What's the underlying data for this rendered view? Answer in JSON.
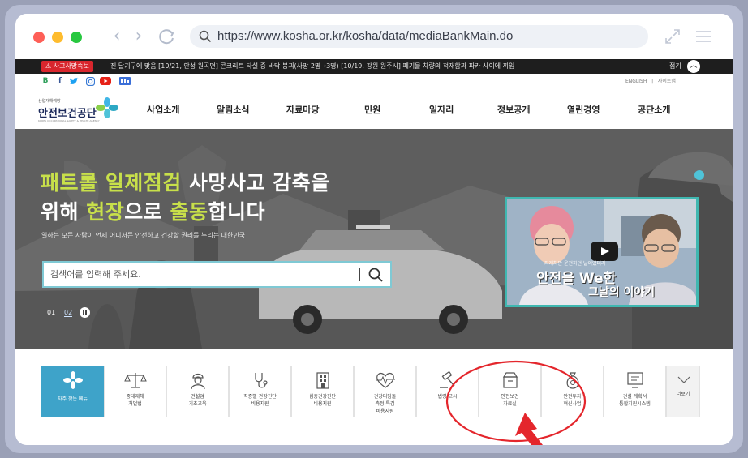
{
  "browser": {
    "url": "https://www.kosha.or.kr/kosha/data/mediaBankMain.do"
  },
  "notice": {
    "badge": "사고사망속보",
    "text": "진 달기구에 맞음   [10/21, 안성 원곡면] 콘크리트 타설 중 바닥 붕괴(사망 2명→3명)   [10/19, 강원 원주시] 폐기물 차량의 적재함과 파카 사이에 끼임",
    "close_label": "접기"
  },
  "util": {
    "sns": [
      "B",
      "f",
      "t",
      "in",
      "yt",
      "cafe"
    ],
    "english": "ENGLISH",
    "sep": "|",
    "sitemap": "사이트맵"
  },
  "logo": {
    "sub": "산업재해예방",
    "name": "안전보건공단",
    "eng": "KOREA OCCUPATIONAL SAFETY & HEALTH AGENCY"
  },
  "gnb": [
    "사업소개",
    "알림소식",
    "자료마당",
    "민원",
    "일자리",
    "정보공개",
    "열린경영",
    "공단소개"
  ],
  "hero": {
    "line1_hl": "패트롤 일제점검",
    "line1_rest": " 사망사고 감축을",
    "line2_a": "위해 ",
    "line2_hl1": "현장",
    "line2_b": "으로 ",
    "line2_hl2": "출동",
    "line2_c": "합니다",
    "sub": "일하는 모든 사람이 언제 어디서든 안전하고 건강할 권리를 누리는 대한민국",
    "search_placeholder": "검색어를 입력해 주세요.",
    "pager": [
      "01",
      "02"
    ]
  },
  "video": {
    "caption_small": "지게차만 운전하던 날이였더라",
    "caption_main": "안전을 We한",
    "caption_sub": "그날의 이야기"
  },
  "quick_menu": [
    {
      "label": "자주 찾는 메뉴"
    },
    {
      "label": "중대재해\n처벌법"
    },
    {
      "label": "건설업\n기초교육"
    },
    {
      "label": "직종별 건강진단\n비용지원"
    },
    {
      "label": "심층건강진단\n비용지원"
    },
    {
      "label": "건강디딤돌\n측정·특검\n비용지원"
    },
    {
      "label": "법령/고시"
    },
    {
      "label": "안전보건\n자료실"
    },
    {
      "label": "안전투자\n혁신사업"
    },
    {
      "label": "건설 계획서\n통합지원시스템"
    },
    {
      "label": "더보기"
    }
  ],
  "colors": {
    "accent": "#3ea3c9",
    "highlight": "#c8e04a",
    "notice_badge": "#d8262d",
    "annotation": "#e4262c"
  }
}
